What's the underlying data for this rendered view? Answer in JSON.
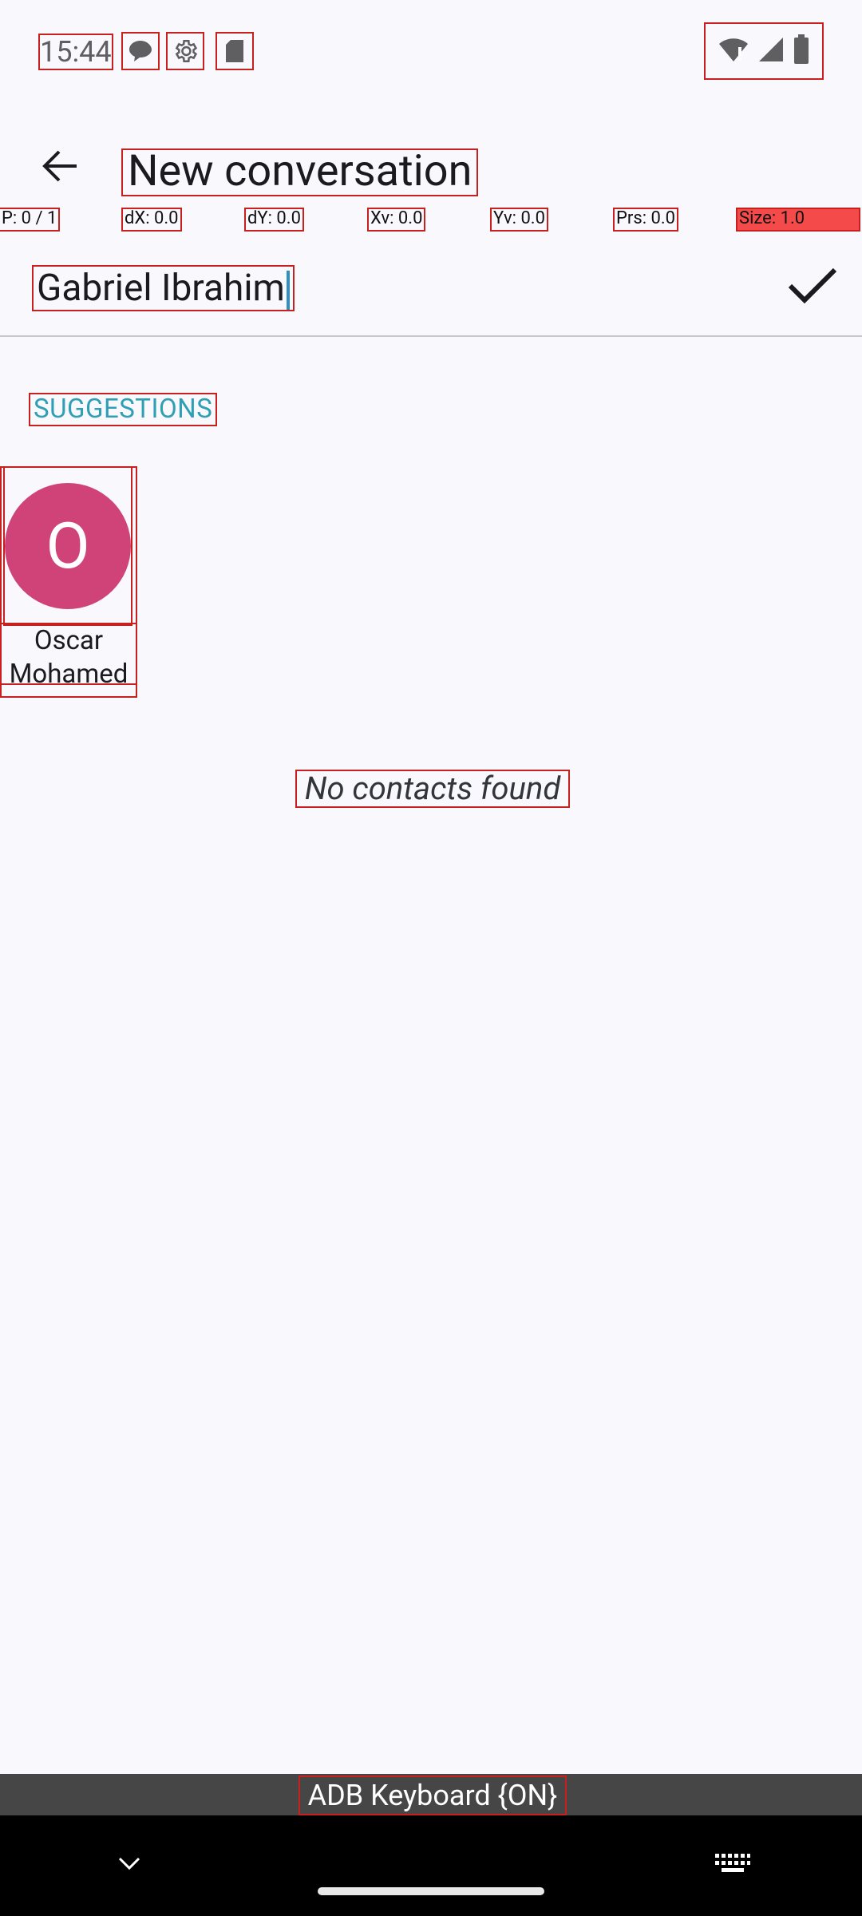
{
  "status_bar": {
    "time": "15:44",
    "left_icons": [
      "chat-bubble-icon",
      "settings-gear-icon",
      "sd-card-icon"
    ],
    "right_icons": [
      "wifi-alert-icon",
      "cell-signal-icon",
      "battery-icon"
    ]
  },
  "pointer_overlay": {
    "p": "P: 0 / 1",
    "dx": "dX: 0.0",
    "dy": "dY: 0.0",
    "xv": "Xv: 0.0",
    "yv": "Yv: 0.0",
    "prs": "Prs: 0.0",
    "size": "Size: 1.0",
    "size_highlight_color": "#f54a4a"
  },
  "app_bar": {
    "title": "New conversation",
    "back_icon": "arrow-back-icon"
  },
  "recipient": {
    "value": "Gabriel Ibrahim",
    "confirm_icon": "checkmark-icon"
  },
  "suggestions": {
    "header": "SUGGESTIONS",
    "header_color": "#2f9fb6",
    "contacts": [
      {
        "initial": "O",
        "name_line1": "Oscar",
        "name_line2": "Mohamed",
        "avatar_color": "#cf4379"
      }
    ]
  },
  "empty_state": {
    "text": "No contacts found"
  },
  "keyboard_banner": {
    "label": "ADB Keyboard {ON}"
  },
  "nav_bar": {
    "left_icon": "chevron-down-icon",
    "right_icon": "keyboard-icon"
  }
}
